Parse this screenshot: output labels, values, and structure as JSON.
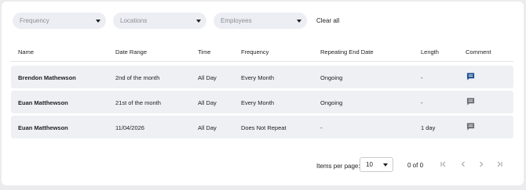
{
  "filters": [
    {
      "placeholder": "Frequency"
    },
    {
      "placeholder": "Locations"
    },
    {
      "placeholder": "Employees"
    }
  ],
  "clear_all_label": "Clear all",
  "table": {
    "headers": [
      "Name",
      "Date Range",
      "Time",
      "Frequency",
      "Repeating End Date",
      "Length",
      "Comment"
    ],
    "rows": [
      {
        "name": "Brendon Mathewson",
        "date_range": "2nd of the month",
        "time": "All Day",
        "frequency": "Every Month",
        "end_date": "Ongoing",
        "length": "-",
        "comment_icon": "comment-filled-icon",
        "icon_color": "#1d4f91"
      },
      {
        "name": "Euan Matthewson",
        "date_range": "21st of the month",
        "time": "All Day",
        "frequency": "Every Month",
        "end_date": "Ongoing",
        "length": "-",
        "comment_icon": "comment-icon",
        "icon_color": "#6b6e74"
      },
      {
        "name": "Euan Matthewson",
        "date_range": "11/04/2026",
        "time": "All Day",
        "frequency": "Does Not Repeat",
        "end_date": "-",
        "length": "1 day",
        "comment_icon": "comment-icon",
        "icon_color": "#6b6e74"
      }
    ]
  },
  "pagination": {
    "items_per_page_label": "Items per page:",
    "items_per_page_value": "10",
    "range_text": "0 of 0",
    "icons": [
      "first-page-icon",
      "previous-page-icon",
      "next-page-icon",
      "last-page-icon"
    ]
  },
  "colors": {
    "row_bg": "#eef0f4",
    "filter_bg": "#eceef3",
    "accent_comment": "#1d4f91"
  }
}
